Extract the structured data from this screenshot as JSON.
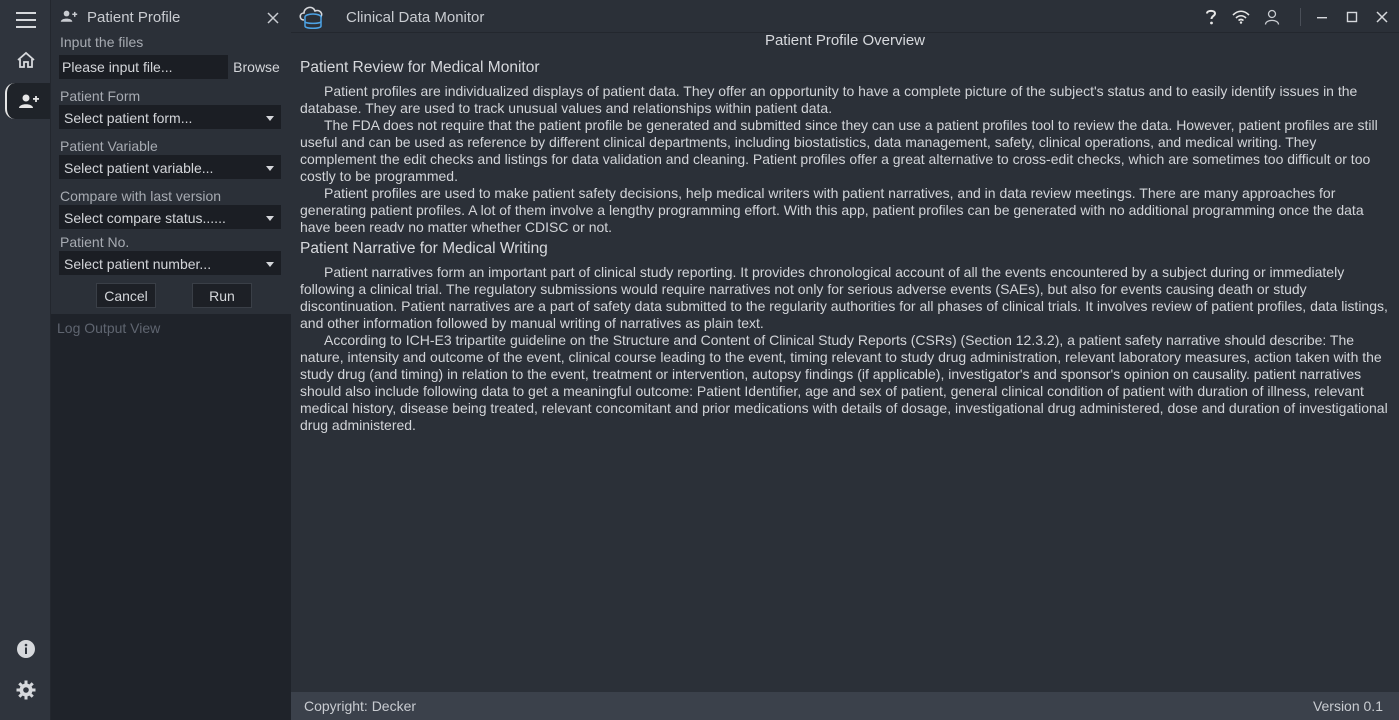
{
  "app": {
    "title": "Clinical Data Monitor"
  },
  "rail": {
    "icons": [
      "menu-icon",
      "home-icon",
      "user-plus-icon",
      "info-icon",
      "gear-icon"
    ]
  },
  "panel": {
    "title": "Patient Profile",
    "input_files_label": "Input the files",
    "input_files_placeholder": "Please input file...",
    "browse_label": "Browse",
    "patient_form_label": "Patient Form",
    "patient_form_value": "Select patient form...",
    "patient_variable_label": "Patient Variable",
    "patient_variable_value": "Select patient variable...",
    "compare_label": "Compare with last version",
    "compare_value": "Select compare status......",
    "patient_no_label": "Patient No.",
    "patient_no_value": "Select patient number...",
    "cancel_label": "Cancel",
    "run_label": "Run",
    "log_label": "Log Output View"
  },
  "content": {
    "overview_title": "Patient Profile Overview",
    "sections": [
      {
        "title": "Patient Review for Medical Monitor",
        "paragraphs": [
          "Patient profiles are individualized displays of patient data. They offer an opportunity to have a complete picture of the subject's status and to easily identify issues in the database. They are used to track unusual values and relationships within patient data.",
          "The FDA does not require that the patient profile be generated and submitted since they can use a patient profiles tool to review the data. However, patient profiles are still useful and can be used as reference by different clinical departments, including biostatistics, data management, safety, clinical operations, and medical writing. They complement the edit checks and listings for data validation and cleaning. Patient profiles offer a great alternative to cross-edit checks, which are sometimes too difficult or too costly to be programmed.",
          "Patient profiles are used to make patient safety decisions, help medical writers with patient narratives, and in data review meetings. There are many approaches for generating patient profiles. A lot of them involve a lengthy programming effort. With this app, patient profiles can be generated with no additional programming once the data have been readv no matter whether CDISC or not."
        ]
      },
      {
        "title": "Patient Narrative for Medical Writing",
        "paragraphs": [
          "Patient narratives form an important part of clinical study reporting. It provides chronological account of all the events encountered by a subject during or immediately following a clinical trial. The regulatory submissions would require narratives not only for serious adverse events (SAEs), but also for events causing death or study discontinuation. Patient narratives are a part of safety data submitted to the regularity authorities for all phases of clinical trials. It involves review of patient profiles, data listings, and other information followed by manual writing of narratives as plain text.",
          "According to ICH-E3 tripartite guideline on the Structure and Content of Clinical Study Reports (CSRs) (Section 12.3.2), a patient safety narrative should describe: The nature, intensity and outcome of the event, clinical course leading to the event, timing relevant to study drug administration, relevant laboratory measures, action taken with the study drug (and timing) in relation to the event, treatment or intervention, autopsy findings (if applicable), investigator's and sponsor's opinion on causality. patient narratives should also include following data to get a meaningful outcome: Patient Identifier, age and sex of patient, general clinical condition of patient with duration of illness, relevant medical history, disease being treated, relevant concomitant and prior medications with details of dosage, investigational drug administered, dose and duration of investigational drug administered."
        ]
      }
    ]
  },
  "status": {
    "copyright": "Copyright: Decker",
    "version": "Version 0.1"
  }
}
